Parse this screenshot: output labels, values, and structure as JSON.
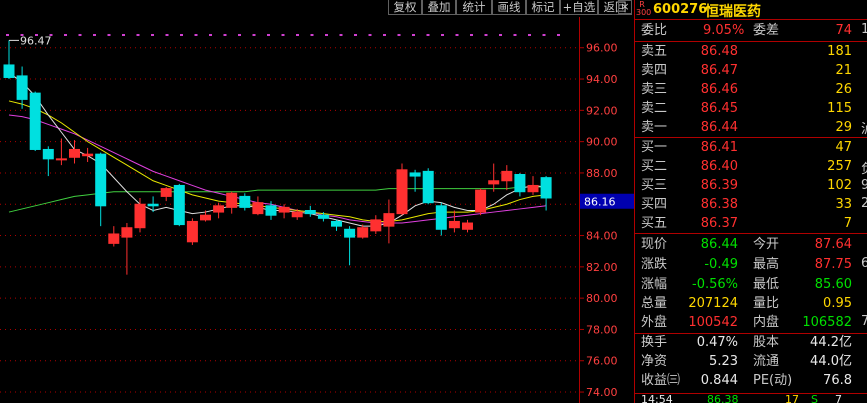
{
  "toolbar": {
    "buttons": [
      "复权",
      "叠加",
      "统计",
      "画线",
      "标记",
      "+自选",
      "返回"
    ],
    "close": "×"
  },
  "stock": {
    "exchange_badge_r": "R",
    "exchange_badge_num": "300",
    "code": "600276",
    "name": "恒瑞医药"
  },
  "commission": {
    "ratio_label": "委比",
    "ratio_value": "9.05%",
    "diff_label": "委差",
    "diff_value": "74"
  },
  "asks": [
    {
      "label": "卖五",
      "price": "86.48",
      "vol": "181"
    },
    {
      "label": "卖四",
      "price": "86.47",
      "vol": "21"
    },
    {
      "label": "卖三",
      "price": "86.46",
      "vol": "26"
    },
    {
      "label": "卖二",
      "price": "86.45",
      "vol": "115"
    },
    {
      "label": "卖一",
      "price": "86.44",
      "vol": "29"
    }
  ],
  "bids": [
    {
      "label": "买一",
      "price": "86.41",
      "vol": "47"
    },
    {
      "label": "买二",
      "price": "86.40",
      "vol": "257"
    },
    {
      "label": "买三",
      "price": "86.39",
      "vol": "102"
    },
    {
      "label": "买四",
      "price": "86.38",
      "vol": "33"
    },
    {
      "label": "买五",
      "price": "86.37",
      "vol": "7"
    }
  ],
  "right_clip": [
    "1",
    "泸",
    "负",
    "9",
    "2",
    "6",
    "7"
  ],
  "quote": {
    "now_label": "现价",
    "now": "86.44",
    "open_label": "今开",
    "open": "87.64",
    "chg_label": "涨跌",
    "chg": "-0.49",
    "high_label": "最高",
    "high": "87.75",
    "pct_label": "涨幅",
    "pct": "-0.56%",
    "low_label": "最低",
    "low": "85.60",
    "vol_label": "总量",
    "vol": "207124",
    "vr_label": "量比",
    "vr": "0.95",
    "outer_label": "外盘",
    "outer": "100542",
    "inner_label": "内盘",
    "inner": "106582"
  },
  "fund": {
    "turn_label": "换手",
    "turn": "0.47%",
    "cap_label": "股本",
    "cap": "44.2亿",
    "nav_label": "净资",
    "nav": "5.23",
    "float_label": "流通",
    "float": "44.0亿",
    "eps_label": "收益㈢",
    "eps": "0.844",
    "pe_label": "PE(动)",
    "pe": "76.8"
  },
  "tick": {
    "time": "14:54",
    "price": "86.38",
    "vol": "17",
    "dir": "S",
    "n": "7"
  },
  "chart_data": {
    "type": "candlestick",
    "ylim": [
      73.3,
      97.9
    ],
    "y_ticks": [
      "96.00",
      "94.00",
      "92.00",
      "90.00",
      "88.00",
      "86.00",
      "84.00",
      "82.00",
      "80.00",
      "78.00",
      "76.00",
      "74.00"
    ],
    "current_price_label": "86.16",
    "high_marker": "96.47",
    "candles": [
      {
        "o": 94.9,
        "c": 94.1,
        "h": 96.47,
        "l": 94.0
      },
      {
        "o": 94.2,
        "c": 92.7,
        "h": 94.8,
        "l": 92.1
      },
      {
        "o": 93.1,
        "c": 89.5,
        "h": 93.2,
        "l": 89.4
      },
      {
        "o": 89.5,
        "c": 88.9,
        "h": 89.7,
        "l": 87.8
      },
      {
        "o": 88.9,
        "c": 88.9,
        "h": 90.2,
        "l": 88.5
      },
      {
        "o": 89.0,
        "c": 89.5,
        "h": 90.1,
        "l": 88.6
      },
      {
        "o": 89.1,
        "c": 89.2,
        "h": 89.6,
        "l": 88.7
      },
      {
        "o": 89.2,
        "c": 85.9,
        "h": 89.3,
        "l": 84.6
      },
      {
        "o": 83.5,
        "c": 84.1,
        "h": 84.6,
        "l": 83.3
      },
      {
        "o": 83.9,
        "c": 84.5,
        "h": 84.8,
        "l": 81.5
      },
      {
        "o": 84.5,
        "c": 86.0,
        "h": 86.4,
        "l": 84.2
      },
      {
        "o": 86.0,
        "c": 85.9,
        "h": 86.5,
        "l": 85.5
      },
      {
        "o": 86.5,
        "c": 87.0,
        "h": 87.1,
        "l": 86.2
      },
      {
        "o": 87.2,
        "c": 84.7,
        "h": 87.3,
        "l": 84.6
      },
      {
        "o": 83.6,
        "c": 84.9,
        "h": 85.1,
        "l": 83.4
      },
      {
        "o": 85.0,
        "c": 85.3,
        "h": 85.6,
        "l": 84.9
      },
      {
        "o": 85.5,
        "c": 85.9,
        "h": 86.1,
        "l": 85.1
      },
      {
        "o": 85.8,
        "c": 86.7,
        "h": 86.8,
        "l": 85.4
      },
      {
        "o": 86.5,
        "c": 85.8,
        "h": 86.7,
        "l": 85.6
      },
      {
        "o": 85.4,
        "c": 86.1,
        "h": 86.5,
        "l": 85.3
      },
      {
        "o": 85.9,
        "c": 85.3,
        "h": 86.2,
        "l": 85.0
      },
      {
        "o": 85.5,
        "c": 85.8,
        "h": 86.0,
        "l": 85.1
      },
      {
        "o": 85.2,
        "c": 85.5,
        "h": 85.7,
        "l": 85.0
      },
      {
        "o": 85.6,
        "c": 85.4,
        "h": 85.9,
        "l": 85.2
      },
      {
        "o": 85.3,
        "c": 85.1,
        "h": 85.5,
        "l": 84.9
      },
      {
        "o": 84.9,
        "c": 84.6,
        "h": 85.0,
        "l": 84.3
      },
      {
        "o": 84.4,
        "c": 83.9,
        "h": 84.6,
        "l": 82.1
      },
      {
        "o": 83.9,
        "c": 84.5,
        "h": 84.7,
        "l": 83.8
      },
      {
        "o": 84.3,
        "c": 85.0,
        "h": 85.3,
        "l": 84.1
      },
      {
        "o": 84.6,
        "c": 85.4,
        "h": 86.3,
        "l": 83.5
      },
      {
        "o": 85.4,
        "c": 88.2,
        "h": 88.6,
        "l": 85.3
      },
      {
        "o": 88.0,
        "c": 87.8,
        "h": 88.2,
        "l": 86.8
      },
      {
        "o": 88.1,
        "c": 86.1,
        "h": 88.3,
        "l": 86.0
      },
      {
        "o": 85.9,
        "c": 84.4,
        "h": 86.1,
        "l": 84.0
      },
      {
        "o": 84.5,
        "c": 84.9,
        "h": 85.6,
        "l": 84.2
      },
      {
        "o": 84.4,
        "c": 84.8,
        "h": 85.0,
        "l": 84.2
      },
      {
        "o": 85.5,
        "c": 86.9,
        "h": 87.0,
        "l": 85.3
      },
      {
        "o": 87.3,
        "c": 87.5,
        "h": 88.6,
        "l": 86.8
      },
      {
        "o": 87.5,
        "c": 88.1,
        "h": 88.5,
        "l": 86.9
      },
      {
        "o": 87.9,
        "c": 86.8,
        "h": 88.0,
        "l": 86.5
      },
      {
        "o": 86.8,
        "c": 87.2,
        "h": 87.8,
        "l": 86.6
      },
      {
        "o": 87.7,
        "c": 86.4,
        "h": 87.8,
        "l": 85.6
      }
    ],
    "ma_white": [
      94.4,
      93.8,
      92.9,
      91.7,
      90.6,
      89.5,
      89.1,
      88.6,
      87.7,
      86.8,
      86.0,
      85.6,
      85.8,
      85.6,
      85.4,
      85.5,
      85.7,
      85.9,
      85.9,
      85.8,
      85.6,
      85.6,
      85.5,
      85.4,
      85.2,
      85.0,
      84.8,
      84.6,
      84.6,
      84.8,
      85.3,
      85.9,
      86.2,
      86.1,
      85.8,
      85.6,
      85.6,
      86.0,
      86.6,
      87.0,
      87.2,
      87.1
    ],
    "ma_yellow": [
      92.6,
      92.4,
      92.1,
      91.7,
      91.2,
      90.6,
      90.0,
      89.5,
      89.0,
      88.5,
      88.0,
      87.5,
      87.2,
      86.9,
      86.6,
      86.4,
      86.2,
      86.1,
      86.0,
      85.9,
      85.8,
      85.7,
      85.6,
      85.5,
      85.4,
      85.3,
      85.2,
      85.0,
      84.9,
      84.9,
      85.0,
      85.2,
      85.4,
      85.5,
      85.5,
      85.5,
      85.6,
      85.8,
      86.0,
      86.3,
      86.5,
      86.6
    ],
    "ma_magenta": [
      91.7,
      91.6,
      91.4,
      91.1,
      90.8,
      90.5,
      90.1,
      89.7,
      89.3,
      88.9,
      88.5,
      88.1,
      87.8,
      87.5,
      87.2,
      86.9,
      86.7,
      86.5,
      86.3,
      86.1,
      86.0,
      85.8,
      85.6,
      85.5,
      85.3,
      85.2,
      85.0,
      84.9,
      84.8,
      84.8,
      84.8,
      84.9,
      85.0,
      85.1,
      85.2,
      85.3,
      85.4,
      85.5,
      85.6,
      85.7,
      85.8,
      85.9
    ],
    "ma_green": [
      85.5,
      85.7,
      85.9,
      86.1,
      86.3,
      86.5,
      86.6,
      86.7,
      86.8,
      86.8,
      86.8,
      86.8,
      86.8,
      86.8,
      86.8,
      86.8,
      86.8,
      86.8,
      86.8,
      86.9,
      86.9,
      86.9,
      86.9,
      86.9,
      86.9,
      86.9,
      86.9,
      86.9,
      86.9,
      87.0,
      87.0,
      87.0,
      87.0,
      87.0,
      87.0,
      87.0,
      87.0,
      87.0,
      87.0,
      87.1,
      87.1,
      87.1
    ]
  },
  "colors": {
    "up": "#ff3030",
    "down": "#00e0e0",
    "grid": "#b00000",
    "ma_white": "#e0e0e0",
    "ma_yellow": "#e8e800",
    "ma_magenta": "#e040e0",
    "ma_green": "#40d040",
    "price_tag_bg": "#0000b0"
  }
}
